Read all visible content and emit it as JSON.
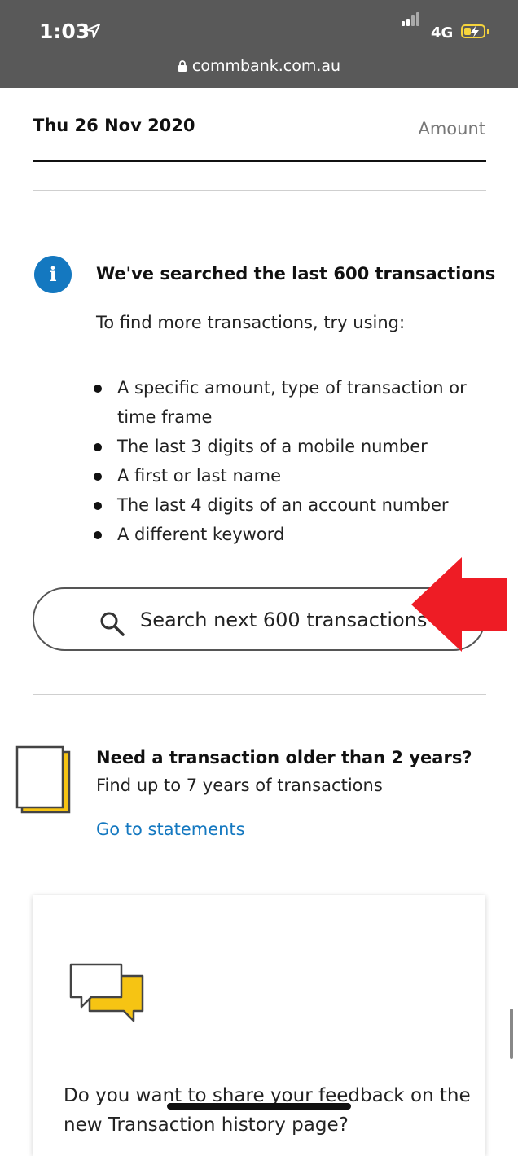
{
  "status_bar": {
    "time": "1:03",
    "network": "4G",
    "url": "commbank.com.au"
  },
  "header": {
    "date": "Thu 26 Nov 2020",
    "amount_label": "Amount"
  },
  "info": {
    "title": "We've searched the last 600 transactions",
    "subtitle": "To find more transactions, try using:",
    "tips": [
      "A specific amount, type of transaction or time frame",
      "The last 3 digits of a mobile number",
      "A first or last name",
      "The last 4 digits of an account number",
      "A different keyword"
    ]
  },
  "search_button": {
    "label": "Search next 600 transactions"
  },
  "older": {
    "title": "Need a transaction older than 2 years?",
    "subtitle": "Find up to 7 years of transactions",
    "link": "Go to statements"
  },
  "feedback": {
    "text": "Do you want to share your feedback on the new Transaction history page?"
  },
  "colors": {
    "accent_blue": "#1478c0",
    "brand_yellow": "#f6c413",
    "annotation_red": "#ee1c25",
    "status_bar_bg": "#595959"
  },
  "icons": {
    "info": "info-icon",
    "search": "search-icon",
    "statements": "document-stack-icon",
    "feedback": "chat-bubbles-icon"
  }
}
